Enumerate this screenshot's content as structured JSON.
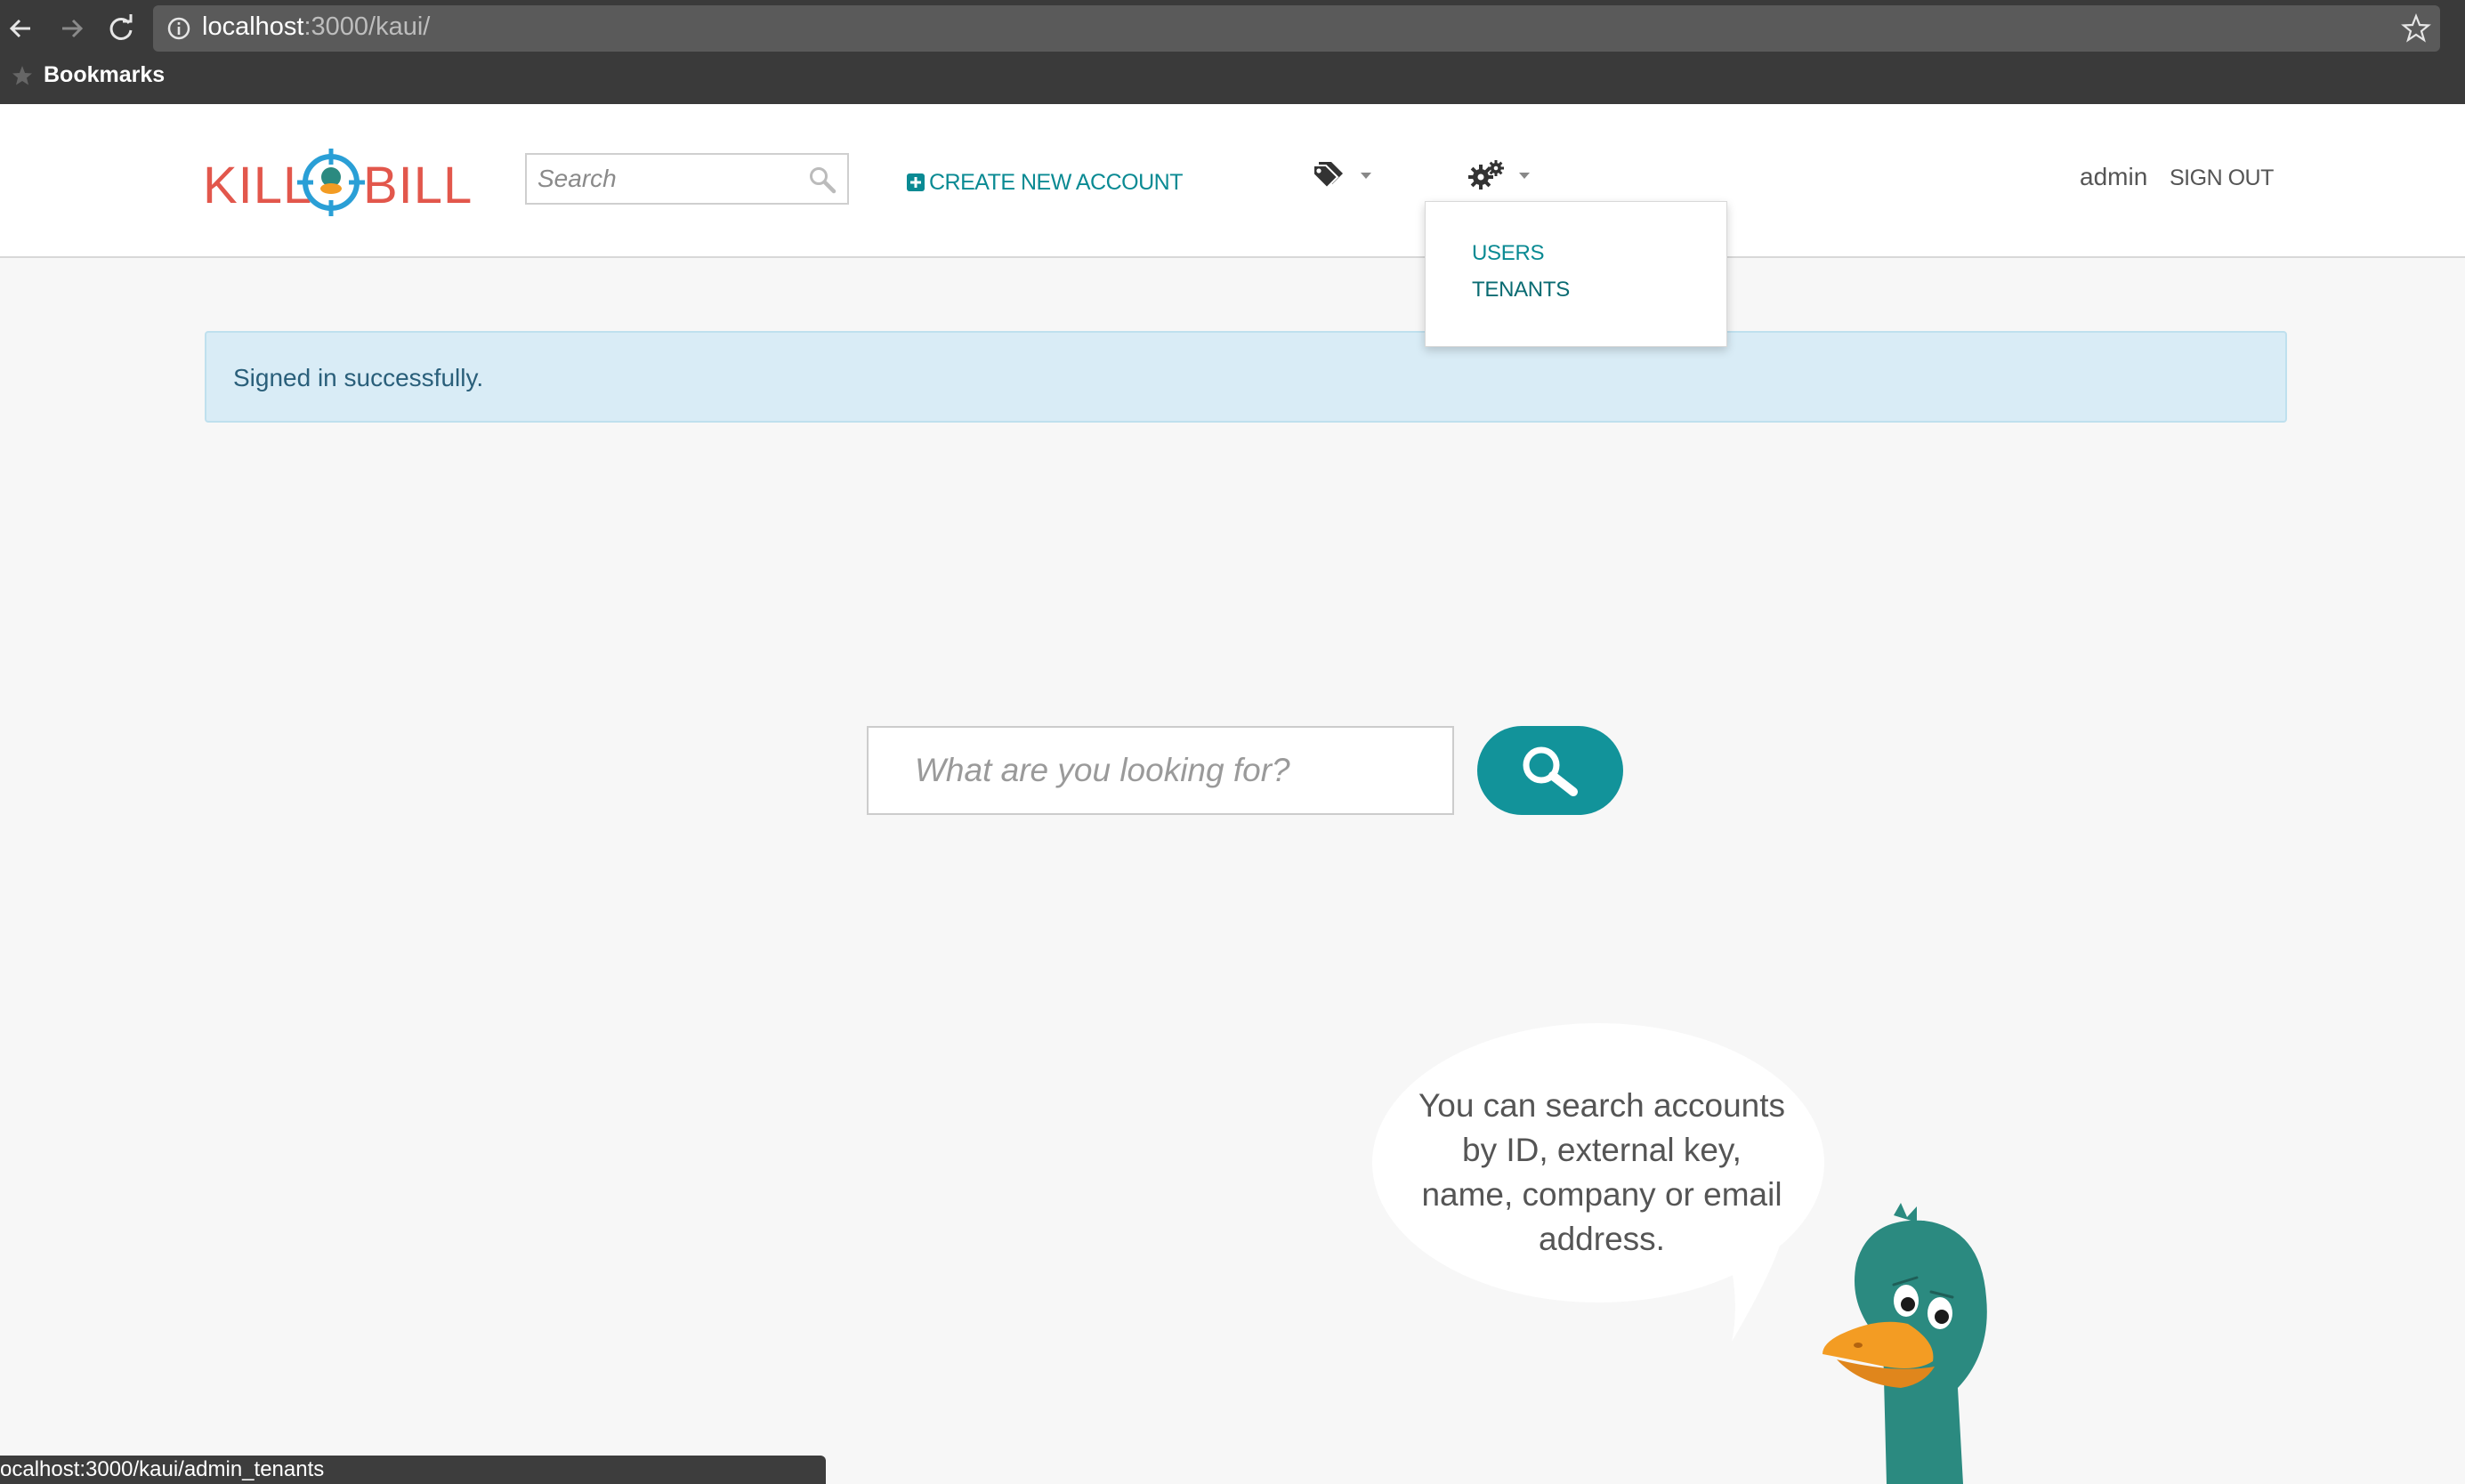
{
  "browser": {
    "url_host": "localhost",
    "url_rest": ":3000/kaui/",
    "bookmarks_label": "Bookmarks",
    "status_url": "ocalhost:3000/kaui/admin_tenants"
  },
  "header": {
    "logo_left": "KILL",
    "logo_right": "BILL",
    "search_placeholder": "Search",
    "create_account_label": "CREATE NEW ACCOUNT",
    "user": "admin",
    "sign_out": "SIGN OUT"
  },
  "admin_menu": {
    "items": [
      {
        "label": "USERS"
      },
      {
        "label": "TENANTS"
      }
    ]
  },
  "alert": {
    "message": "Signed in successfully."
  },
  "main_search": {
    "placeholder": "What are you looking for?"
  },
  "bubble": {
    "text": "You can search accounts by ID, external key, name, company or email address."
  },
  "colors": {
    "accent": "#12939a",
    "logo": "#e2574c",
    "alert_bg": "#d9ecf6",
    "duck": "#2b8a80"
  }
}
